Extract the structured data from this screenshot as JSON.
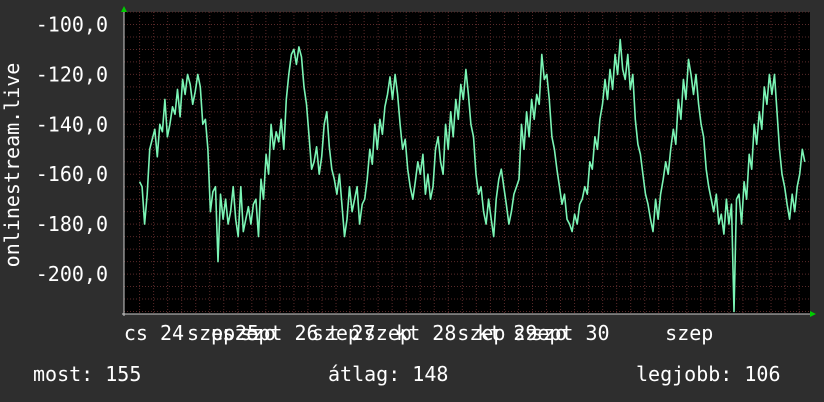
{
  "chart_data": {
    "type": "line",
    "ylabel": "onlinestream.live",
    "ylim": [
      -216,
      -95
    ],
    "yticks": [
      -100,
      -120,
      -140,
      -160,
      -180,
      -200
    ],
    "ytick_labels": [
      "-100,0",
      "-120,0",
      "-140,0",
      "-160,0",
      "-180,0",
      "-200,0"
    ],
    "xlim": [
      0,
      6.6
    ],
    "xticks": [
      {
        "x": 0.5,
        "label": "cs 24"
      },
      {
        "x": 1.05,
        "label": "szep"
      },
      {
        "x": 1.28,
        "label": "p 25"
      },
      {
        "x": 1.5,
        "label": "szo"
      },
      {
        "x": 1.62,
        "label": "szept 26"
      },
      {
        "x": 2.25,
        "label": "szep"
      },
      {
        "x": 2.4,
        "label": "t 27"
      },
      {
        "x": 2.75,
        "label": "szep"
      },
      {
        "x": 3.12,
        "label": "kt 28"
      },
      {
        "x": 3.65,
        "label": "szep"
      },
      {
        "x": 3.9,
        "label": "kt 29"
      },
      {
        "x": 4.3,
        "label": "szo"
      },
      {
        "x": 4.42,
        "label": "szept 30"
      },
      {
        "x": 5.65,
        "label": "szep"
      }
    ],
    "grid": true,
    "colors": {
      "background": "#000000",
      "grid": "#5a2a2a",
      "line": "#7bf5b5",
      "axis_arrow": "#00cc00"
    },
    "series": [
      {
        "values": [
          -163,
          -165,
          -180,
          -168,
          -150,
          -146,
          -142,
          -153,
          -140,
          -143,
          -130,
          -145,
          -140,
          -133,
          -136,
          -126,
          -137,
          -122,
          -128,
          -120,
          -124,
          -132,
          -127,
          -120,
          -125,
          -140,
          -138,
          -150,
          -175,
          -167,
          -165,
          -195,
          -168,
          -178,
          -170,
          -180,
          -175,
          -165,
          -178,
          -185,
          -165,
          -183,
          -178,
          -173,
          -180,
          -172,
          -170,
          -185,
          -162,
          -170,
          -152,
          -160,
          -140,
          -150,
          -143,
          -147,
          -138,
          -150,
          -130,
          -120,
          -112,
          -110,
          -116,
          -109,
          -113,
          -125,
          -132,
          -145,
          -158,
          -155,
          -149,
          -160,
          -153,
          -140,
          -135,
          -149,
          -158,
          -162,
          -168,
          -160,
          -172,
          -185,
          -178,
          -165,
          -175,
          -170,
          -165,
          -180,
          -172,
          -170,
          -162,
          -150,
          -156,
          -140,
          -150,
          -138,
          -144,
          -133,
          -128,
          -121,
          -130,
          -120,
          -128,
          -140,
          -150,
          -146,
          -158,
          -165,
          -170,
          -163,
          -155,
          -160,
          -152,
          -168,
          -160,
          -170,
          -165,
          -150,
          -145,
          -155,
          -160,
          -140,
          -150,
          -135,
          -145,
          -130,
          -138,
          -124,
          -130,
          -118,
          -128,
          -140,
          -145,
          -160,
          -168,
          -165,
          -175,
          -180,
          -170,
          -178,
          -185,
          -170,
          -162,
          -158,
          -165,
          -172,
          -180,
          -175,
          -168,
          -165,
          -162,
          -140,
          -150,
          -135,
          -145,
          -130,
          -138,
          -128,
          -132,
          -112,
          -122,
          -120,
          -130,
          -145,
          -150,
          -158,
          -165,
          -172,
          -168,
          -178,
          -180,
          -183,
          -176,
          -180,
          -172,
          -170,
          -165,
          -168,
          -155,
          -158,
          -145,
          -150,
          -138,
          -132,
          -122,
          -130,
          -118,
          -126,
          -112,
          -120,
          -106,
          -118,
          -122,
          -112,
          -126,
          -120,
          -138,
          -148,
          -152,
          -160,
          -168,
          -172,
          -178,
          -183,
          -170,
          -178,
          -168,
          -162,
          -155,
          -160,
          -150,
          -142,
          -148,
          -130,
          -138,
          -122,
          -130,
          -114,
          -120,
          -128,
          -120,
          -132,
          -140,
          -145,
          -158,
          -165,
          -170,
          -175,
          -168,
          -180,
          -176,
          -184,
          -170,
          -180,
          -172,
          -215,
          -170,
          -168,
          -180,
          -163,
          -170,
          -152,
          -158,
          -140,
          -148,
          -135,
          -142,
          -125,
          -132,
          -120,
          -128,
          -120,
          -135,
          -150,
          -160,
          -165,
          -172,
          -178,
          -168,
          -175,
          -165,
          -160,
          -150,
          -155
        ],
        "x_range": [
          0.15,
          6.55
        ]
      }
    ]
  },
  "footer": {
    "current": "most: 155",
    "average": "átlag: 148",
    "best": "legjobb: 106"
  }
}
